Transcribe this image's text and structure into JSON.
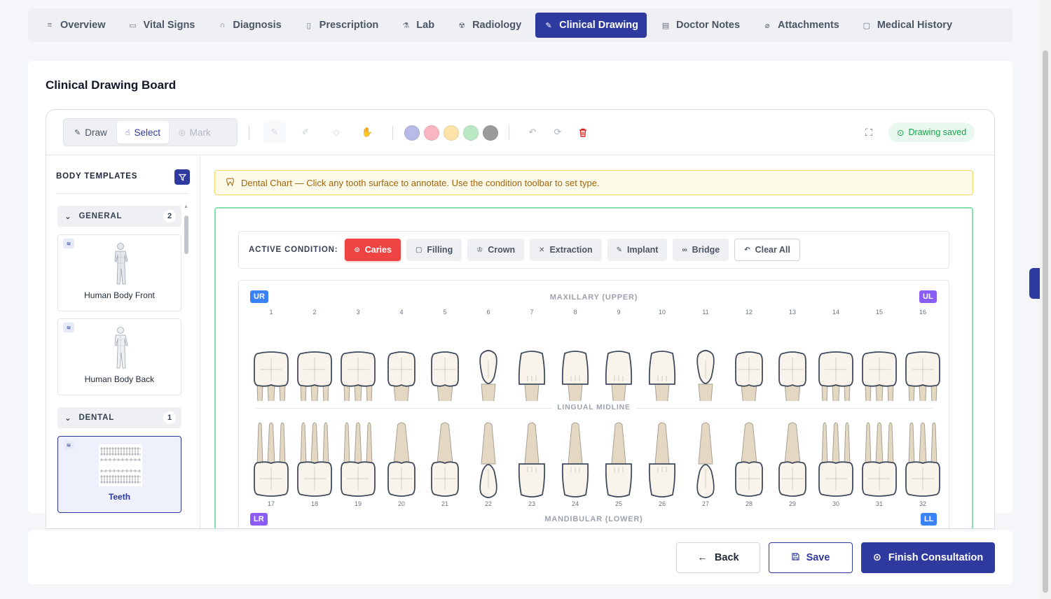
{
  "tabs": [
    {
      "label": "Overview",
      "icon": "list-icon",
      "glyph": "≡",
      "active": false
    },
    {
      "label": "Vital Signs",
      "icon": "monitor-icon",
      "glyph": "▭",
      "active": false
    },
    {
      "label": "Diagnosis",
      "icon": "stethoscope-icon",
      "glyph": "∩",
      "active": false
    },
    {
      "label": "Prescription",
      "icon": "bottle-icon",
      "glyph": "▯",
      "active": false
    },
    {
      "label": "Lab",
      "icon": "flask-icon",
      "glyph": "⚗",
      "active": false
    },
    {
      "label": "Radiology",
      "icon": "radiation-icon",
      "glyph": "☢",
      "active": false
    },
    {
      "label": "Clinical Drawing",
      "icon": "signature-icon",
      "glyph": "✎",
      "active": true
    },
    {
      "label": "Doctor Notes",
      "icon": "clipboard-icon",
      "glyph": "▤",
      "active": false
    },
    {
      "label": "Attachments",
      "icon": "paperclip-icon",
      "glyph": "⌀",
      "active": false
    },
    {
      "label": "Medical History",
      "icon": "file-search-icon",
      "glyph": "▢",
      "active": false
    }
  ],
  "card": {
    "title": "Clinical Drawing Board"
  },
  "toolbar": {
    "modes": [
      {
        "label": "Draw",
        "icon": "pen-icon",
        "glyph": "✎",
        "state": "normal"
      },
      {
        "label": "Select",
        "icon": "hand-pointer-icon",
        "glyph": "☝",
        "state": "active"
      },
      {
        "label": "Mark",
        "icon": "map-pin-icon",
        "glyph": "◎",
        "state": "disabled"
      }
    ],
    "tools": [
      {
        "name": "pencil-tool-icon",
        "glyph": "✎"
      },
      {
        "name": "highlighter-tool-icon",
        "glyph": "✐"
      },
      {
        "name": "eraser-tool-icon",
        "glyph": "◇"
      },
      {
        "name": "pan-tool-icon",
        "glyph": "✋"
      }
    ],
    "colors": [
      "#b7bbe6",
      "#f9b5c1",
      "#fde3a7",
      "#b9e8c3",
      "#9b9b9b"
    ],
    "status": "Drawing saved"
  },
  "sidebar": {
    "heading": "BODY TEMPLATES",
    "groups": [
      {
        "name": "GENERAL",
        "count": "2"
      },
      {
        "name": "DENTAL",
        "count": "1"
      }
    ],
    "templates": [
      {
        "label": "Human Body Front",
        "selected": false
      },
      {
        "label": "Human Body Back",
        "selected": false
      },
      {
        "label": "Teeth",
        "selected": true
      }
    ]
  },
  "notice": "Dental Chart — Click any tooth surface to annotate. Use the condition toolbar to set type.",
  "conditions": {
    "label": "ACTIVE CONDITION:",
    "items": [
      {
        "label": "Caries",
        "icon": "target-icon",
        "glyph": "⊙",
        "active": true
      },
      {
        "label": "Filling",
        "icon": "square-icon",
        "glyph": "▢",
        "active": false
      },
      {
        "label": "Crown",
        "icon": "crown-icon",
        "glyph": "♔",
        "active": false
      },
      {
        "label": "Extraction",
        "icon": "x-icon",
        "glyph": "✕",
        "active": false
      },
      {
        "label": "Implant",
        "icon": "wrench-icon",
        "glyph": "✎",
        "active": false
      },
      {
        "label": "Bridge",
        "icon": "link-icon",
        "glyph": "∞",
        "active": false
      }
    ],
    "clear_label": "Clear All"
  },
  "dental_chart": {
    "upper_title": "MAXILLARY (UPPER)",
    "lower_title": "MANDIBULAR (LOWER)",
    "midline": "LINGUAL MIDLINE",
    "quadrants": {
      "ur": "UR",
      "ul": "UL",
      "lr": "LR",
      "ll": "LL"
    },
    "upper_teeth": [
      {
        "n": "1",
        "type": "molar"
      },
      {
        "n": "2",
        "type": "molar"
      },
      {
        "n": "3",
        "type": "molar"
      },
      {
        "n": "4",
        "type": "premolar"
      },
      {
        "n": "5",
        "type": "premolar"
      },
      {
        "n": "6",
        "type": "canine"
      },
      {
        "n": "7",
        "type": "incisor"
      },
      {
        "n": "8",
        "type": "incisor"
      },
      {
        "n": "9",
        "type": "incisor"
      },
      {
        "n": "10",
        "type": "incisor"
      },
      {
        "n": "11",
        "type": "canine"
      },
      {
        "n": "12",
        "type": "premolar"
      },
      {
        "n": "13",
        "type": "premolar"
      },
      {
        "n": "14",
        "type": "molar"
      },
      {
        "n": "15",
        "type": "molar"
      },
      {
        "n": "16",
        "type": "molar"
      }
    ],
    "lower_teeth": [
      {
        "n": "17",
        "type": "molar"
      },
      {
        "n": "18",
        "type": "molar"
      },
      {
        "n": "19",
        "type": "molar"
      },
      {
        "n": "20",
        "type": "premolar"
      },
      {
        "n": "21",
        "type": "premolar"
      },
      {
        "n": "22",
        "type": "canine"
      },
      {
        "n": "23",
        "type": "incisor"
      },
      {
        "n": "24",
        "type": "incisor"
      },
      {
        "n": "25",
        "type": "incisor"
      },
      {
        "n": "26",
        "type": "incisor"
      },
      {
        "n": "27",
        "type": "canine"
      },
      {
        "n": "28",
        "type": "premolar"
      },
      {
        "n": "29",
        "type": "premolar"
      },
      {
        "n": "30",
        "type": "molar"
      },
      {
        "n": "31",
        "type": "molar"
      },
      {
        "n": "32",
        "type": "molar"
      }
    ]
  },
  "footer": {
    "back": "Back",
    "save": "Save",
    "finish": "Finish Consultation"
  }
}
